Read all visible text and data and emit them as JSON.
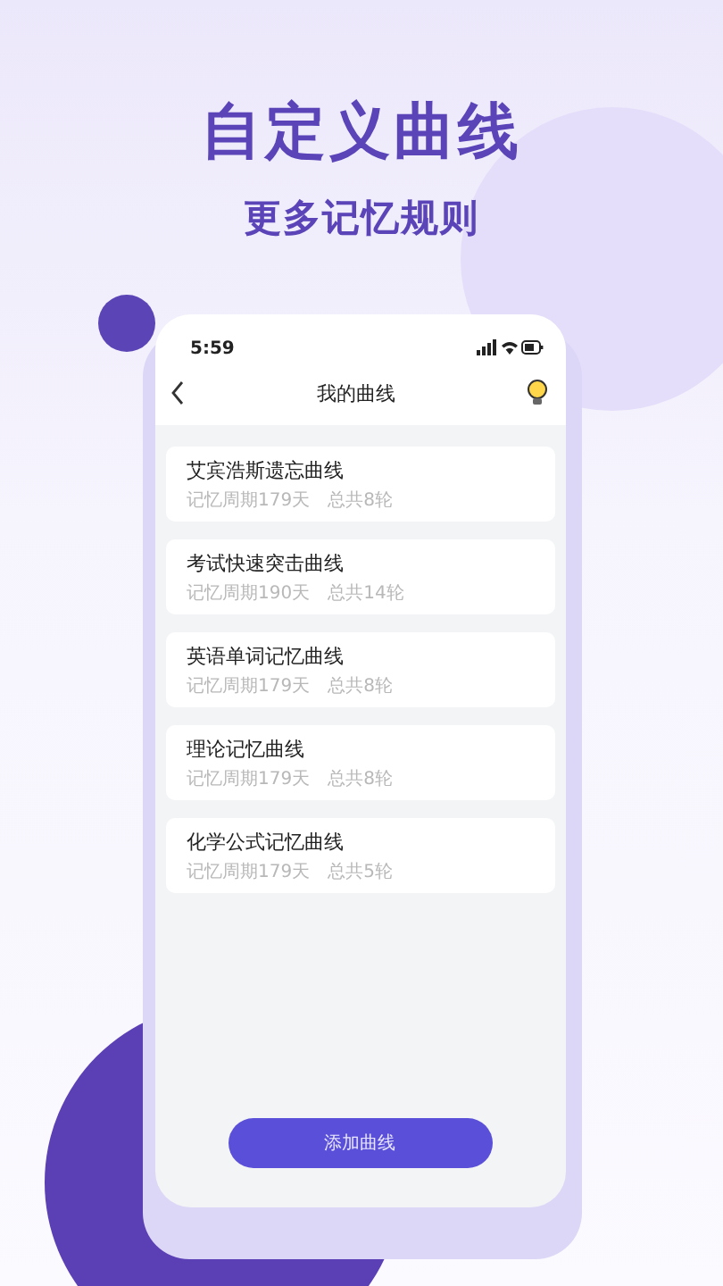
{
  "headline": "自定义曲线",
  "subtitle": "更多记忆规则",
  "status_bar": {
    "time": "5:59"
  },
  "nav": {
    "title": "我的曲线"
  },
  "curves": [
    {
      "name": "艾宾浩斯遗忘曲线",
      "period": "记忆周期179天",
      "total": "总共8轮"
    },
    {
      "name": "考试快速突击曲线",
      "period": "记忆周期190天",
      "total": "总共14轮"
    },
    {
      "name": "英语单词记忆曲线",
      "period": "记忆周期179天",
      "total": "总共8轮"
    },
    {
      "name": "理论记忆曲线",
      "period": "记忆周期179天",
      "total": "总共8轮"
    },
    {
      "name": "化学公式记忆曲线",
      "period": "记忆周期179天",
      "total": "总共5轮"
    }
  ],
  "add_button": "添加曲线"
}
